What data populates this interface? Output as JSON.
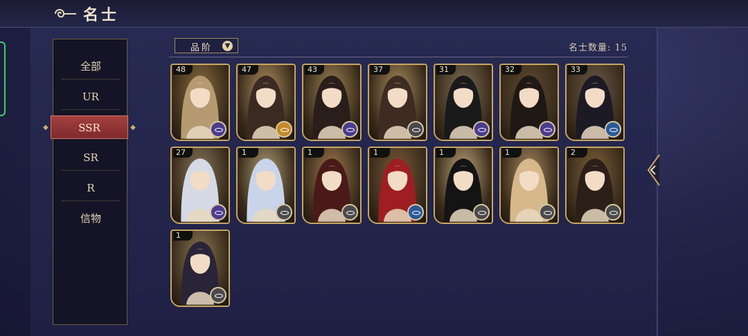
{
  "header": {
    "title": "名士",
    "icon": "cloud-swirl-icon"
  },
  "nav": {
    "items": [
      {
        "label": "全部"
      },
      {
        "label": "UR"
      },
      {
        "label": "SSR"
      },
      {
        "label": "SR"
      },
      {
        "label": "R"
      },
      {
        "label": "信物"
      }
    ],
    "active": "SSR"
  },
  "filter": {
    "label": "品阶",
    "icon": "chevron-down-icon"
  },
  "count_text": "名士数量: 15",
  "colors": {
    "active_tab": "#a5403f",
    "card_border": "#c7a664",
    "accent_gold": "#c9ae72"
  },
  "cards": [
    {
      "level": "48",
      "badge": "purple",
      "hair": "#b59a72",
      "bg": "#8a6d3c"
    },
    {
      "level": "47",
      "badge": "orange",
      "hair": "#3a2a22",
      "bg": "#b09060"
    },
    {
      "level": "43",
      "badge": "purple",
      "hair": "#2a1e1a",
      "bg": "#9f8454"
    },
    {
      "level": "37",
      "badge": "gray",
      "hair": "#3e2c22",
      "bg": "#a98d5e"
    },
    {
      "level": "31",
      "badge": "purple",
      "hair": "#1a1a1a",
      "bg": "#807058"
    },
    {
      "level": "32",
      "badge": "purple",
      "hair": "#201814",
      "bg": "#5e4a30"
    },
    {
      "level": "33",
      "badge": "blue",
      "hair": "#1c1a24",
      "bg": "#6a5a48"
    },
    {
      "level": "27",
      "badge": "purple",
      "hair": "#d6dae6",
      "bg": "#8a7a60"
    },
    {
      "level": "1",
      "badge": "gray",
      "hair": "#c9d4ea",
      "bg": "#b0a078"
    },
    {
      "level": "1",
      "badge": "gray",
      "hair": "#4a1a18",
      "bg": "#a07a50"
    },
    {
      "level": "1",
      "badge": "blue",
      "hair": "#9e1e22",
      "bg": "#7a5a38"
    },
    {
      "level": "1",
      "badge": "gray",
      "hair": "#141414",
      "bg": "#c0a87a"
    },
    {
      "level": "1",
      "badge": "gray",
      "hair": "#d6b88a",
      "bg": "#a88a60"
    },
    {
      "level": "2",
      "badge": "gray",
      "hair": "#2c1e18",
      "bg": "#7e6238"
    },
    {
      "level": "1",
      "badge": "gray",
      "hair": "#2a2438",
      "bg": "#8e7a54"
    }
  ]
}
